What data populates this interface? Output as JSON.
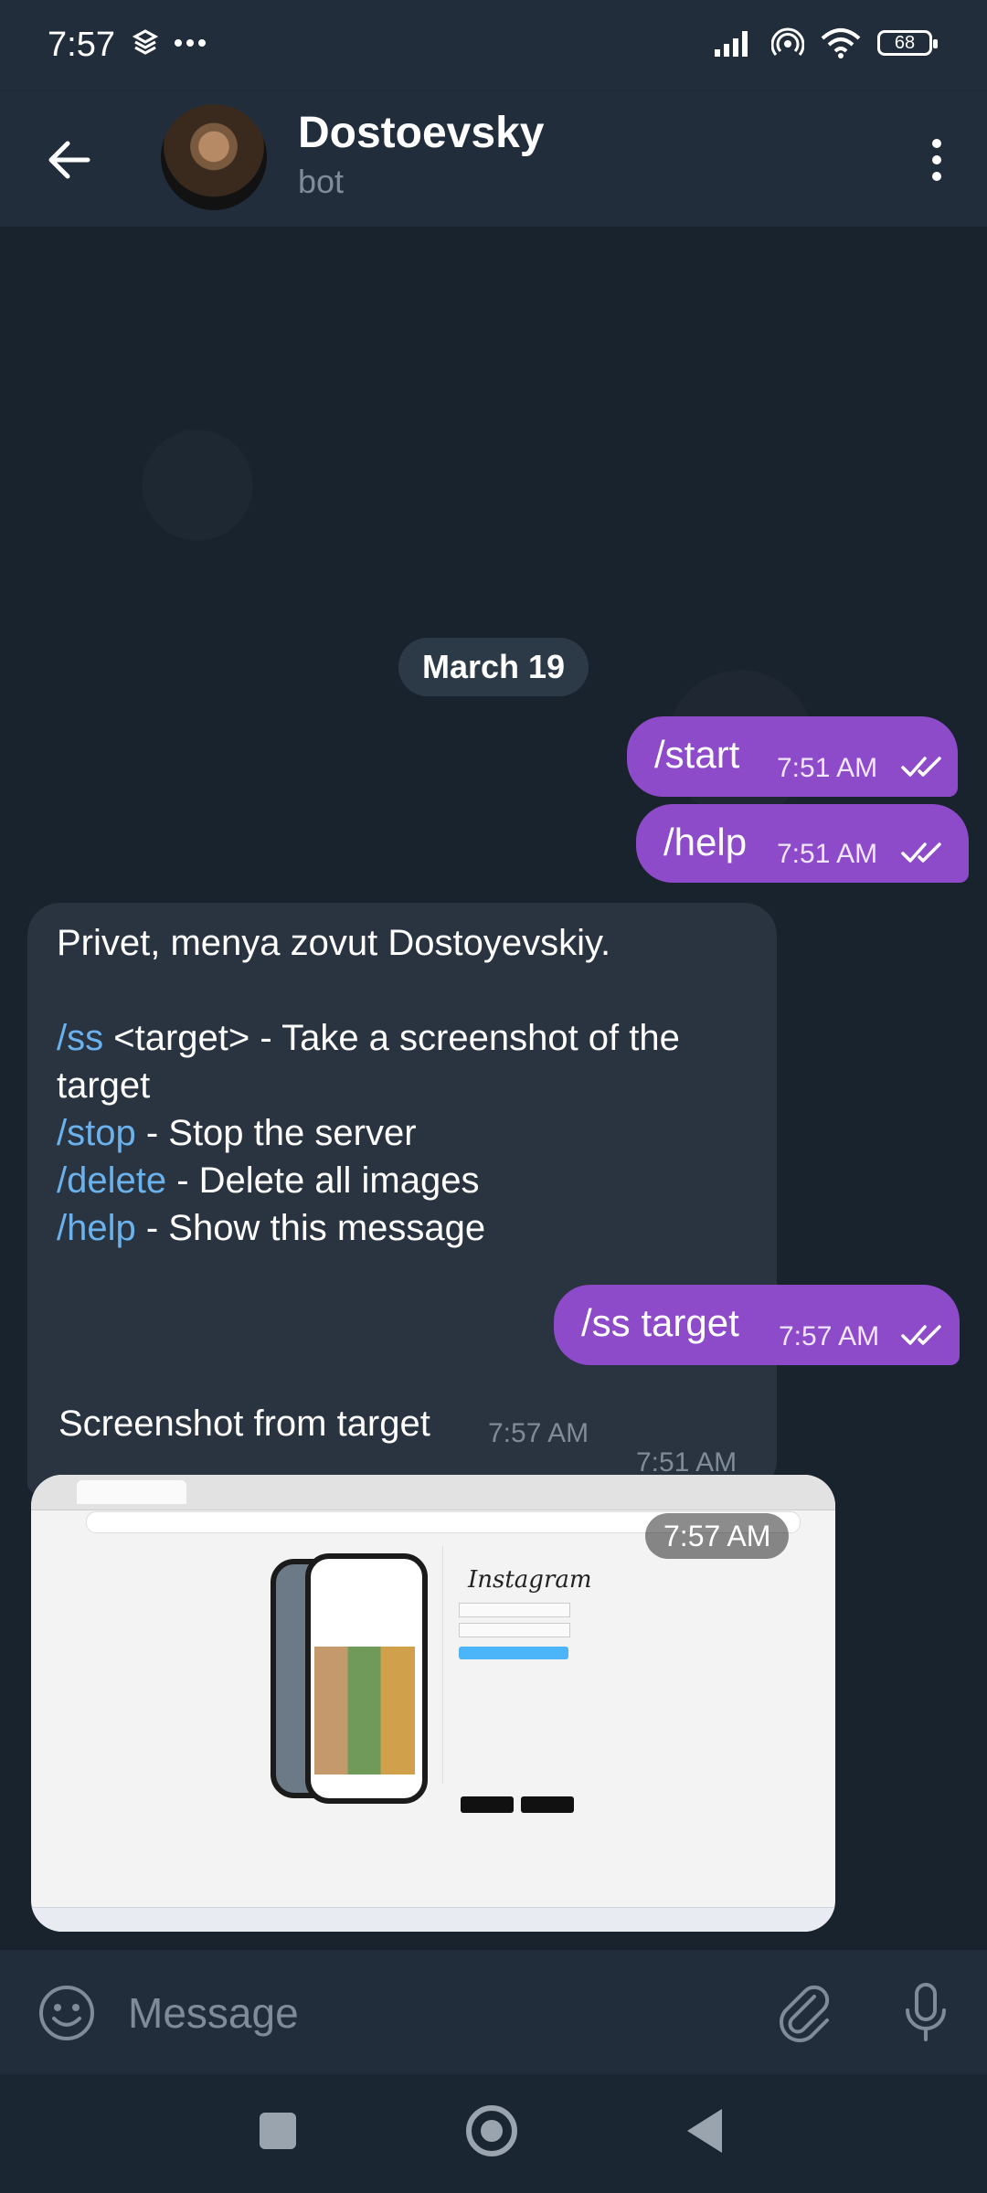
{
  "status_bar": {
    "time": "7:57",
    "battery": "68"
  },
  "header": {
    "title": "Dostoevsky",
    "subtitle": "bot"
  },
  "chat": {
    "date": "March 19",
    "messages": [
      {
        "text": "/start",
        "time": "7:51 AM"
      },
      {
        "text": "/help",
        "time": "7:51 AM"
      },
      {
        "greeting": "Privet, menya zovut Dostoyevskiy.",
        "lines": [
          {
            "cmd": "/ss",
            "desc": " <target> - Take a screenshot of the target"
          },
          {
            "cmd": "/stop",
            "desc": " - Stop the server"
          },
          {
            "cmd": "/delete",
            "desc": " - Delete all images"
          },
          {
            "cmd": "/help",
            "desc": " - Show this message"
          }
        ],
        "time": "7:51 AM"
      },
      {
        "text": "/ss target",
        "time": "7:57 AM"
      },
      {
        "text": "Screenshot from target",
        "time": "7:57 AM"
      },
      {
        "image_brand": "Instagram",
        "time": "7:57 AM"
      }
    ]
  },
  "input": {
    "placeholder": "Message"
  },
  "icons": {
    "back": "arrow-left-icon",
    "menu": "more-vertical-icon",
    "emoji": "smiley-icon",
    "attach": "paperclip-icon",
    "mic": "microphone-icon",
    "share": "share-forward-icon",
    "read": "double-check-icon"
  },
  "colors": {
    "outgoing_bubble": "#8d4ac9",
    "incoming_bubble": "#2a3441",
    "command_link": "#6bb2ed",
    "header_bg": "#212d3b",
    "chat_bg": "#19232e"
  }
}
